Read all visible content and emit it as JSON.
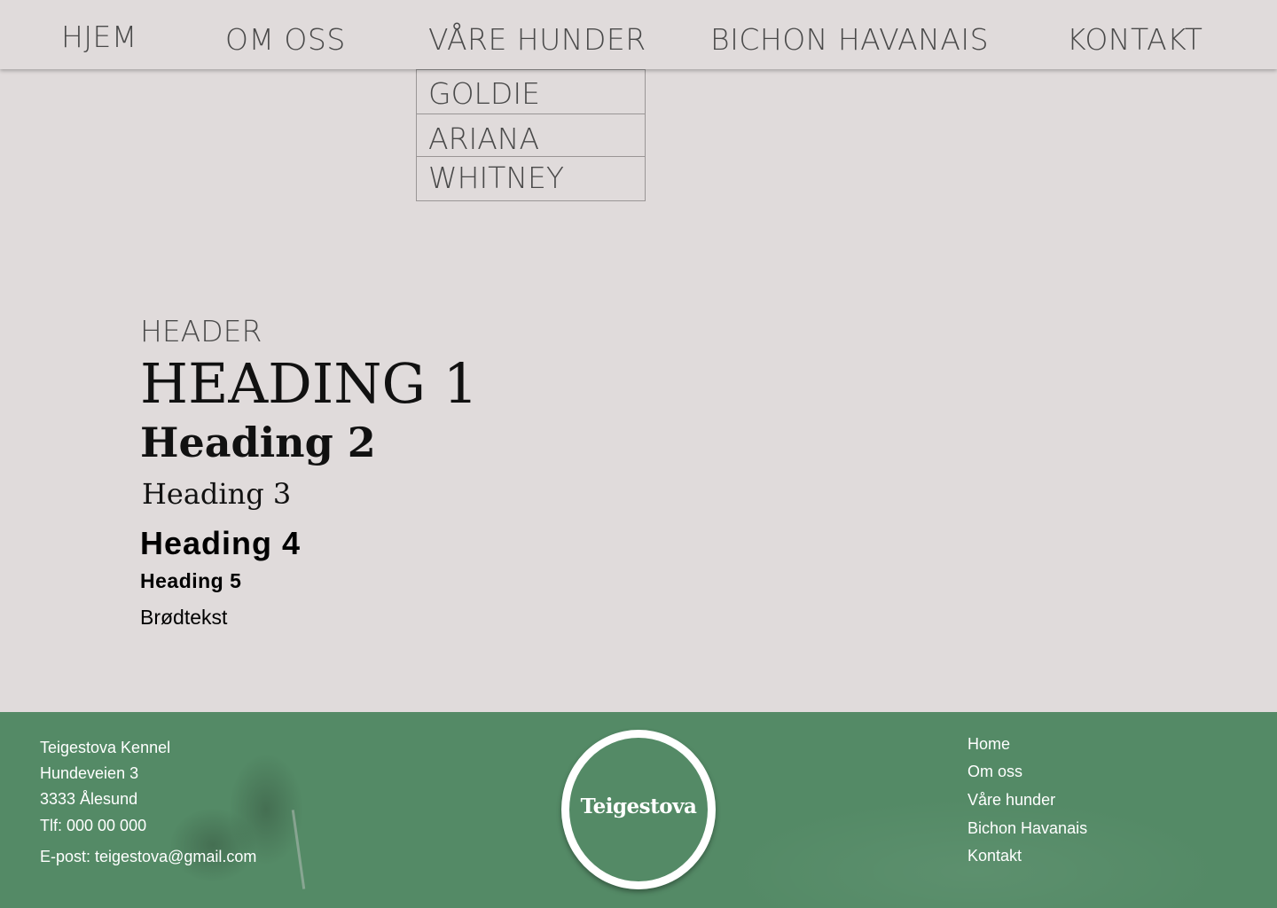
{
  "nav": {
    "items": [
      {
        "label": "HJEM"
      },
      {
        "label": "OM OSS"
      },
      {
        "label": "VÅRE HUNDER"
      },
      {
        "label": "BICHON HAVANAIS"
      },
      {
        "label": "KONTAKT"
      }
    ]
  },
  "dropdown": {
    "items": [
      {
        "label": "GOLDIE"
      },
      {
        "label": "ARIANA"
      },
      {
        "label": "WHITNEY"
      }
    ]
  },
  "style_guide": {
    "header": "HEADER",
    "heading1": "HEADING 1",
    "heading2": "Heading 2",
    "heading3": "Heading 3",
    "heading4": "Heading 4",
    "heading5": "Heading 5",
    "body": "Brødtekst"
  },
  "footer": {
    "company": "Teigestova Kennel",
    "street": "Hundeveien 3",
    "city": "3333 Ålesund",
    "phone": "Tlf: 000 00 000",
    "email": "E-post: teigestova@gmail.com",
    "logo_text": "Teigestova",
    "nav": [
      {
        "label": "Home"
      },
      {
        "label": "Om oss"
      },
      {
        "label": "Våre hunder"
      },
      {
        "label": "Bichon Havanais"
      },
      {
        "label": "Kontakt"
      }
    ]
  },
  "colors": {
    "background": "#e0dbdb",
    "nav_text": "#4a4a4a",
    "footer_green": "#548a66",
    "footer_text": "#ffffff"
  }
}
